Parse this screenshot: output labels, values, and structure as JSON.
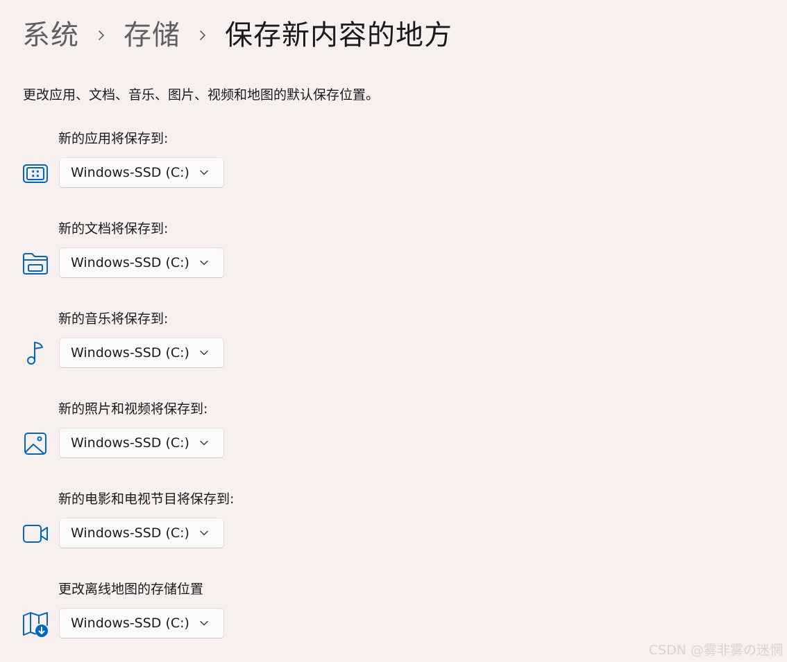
{
  "breadcrumb": {
    "items": [
      "系统",
      "存储",
      "保存新内容的地方"
    ]
  },
  "description": "更改应用、文档、音乐、图片、视频和地图的默认保存位置。",
  "accent_color": "#0067c0",
  "settings": [
    {
      "label": "新的应用将保存到:",
      "value": "Windows-SSD (C:)",
      "icon": "apps-icon"
    },
    {
      "label": "新的文档将保存到:",
      "value": "Windows-SSD (C:)",
      "icon": "folder-icon"
    },
    {
      "label": "新的音乐将保存到:",
      "value": "Windows-SSD (C:)",
      "icon": "music-note-icon"
    },
    {
      "label": "新的照片和视频将保存到:",
      "value": "Windows-SSD (C:)",
      "icon": "picture-icon"
    },
    {
      "label": "新的电影和电视节目将保存到:",
      "value": "Windows-SSD (C:)",
      "icon": "video-camera-icon"
    },
    {
      "label": "更改离线地图的存储位置",
      "value": "Windows-SSD (C:)",
      "icon": "map-download-icon"
    }
  ],
  "watermark": "CSDN @雾非雾の迷惘"
}
